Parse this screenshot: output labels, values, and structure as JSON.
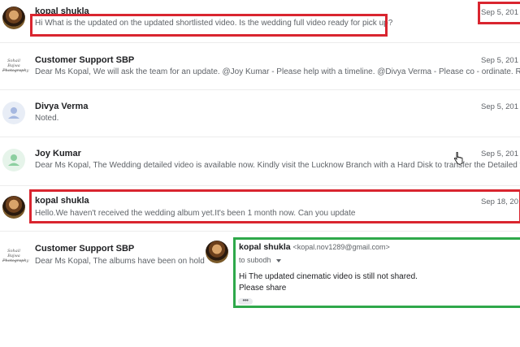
{
  "messages": [
    {
      "sender": "kopal shukla",
      "snippet": "Hi What is the updated on the updated shortlisted video. Is the wedding full video ready for pick up?",
      "date": "Sep 5, 201"
    },
    {
      "sender": "Customer Support SBP",
      "snippet": "Dear Ms Kopal, We will ask the team for an update. @Joy Kumar - Please help with a timeline. @Divya Verma - Please co - ordinate. Rega",
      "date": "Sep 5, 201"
    },
    {
      "sender": "Divya Verma",
      "snippet": "Noted.",
      "date": "Sep 5, 201"
    },
    {
      "sender": "Joy Kumar",
      "snippet": "Dear Ms Kopal, The Wedding detailed video is available now. Kindly visit the Lucknow Branch with a Hard Disk to transfer the Detailed vide",
      "date": "Sep 5, 201"
    },
    {
      "sender": "kopal shukla",
      "snippet": "Hello.We haven't received the wedding album yet.It's been 1 month now. Can you update",
      "date": "Sep 18, 20"
    },
    {
      "sender": "Customer Support SBP",
      "snippet": "Dear Ms Kopal, The albums have been on hold",
      "date": ""
    }
  ],
  "logo_text": "Sohail Bajwa Photography",
  "expanded": {
    "sender": "kopal shukla",
    "email": "<kopal.nov1289@gmail.com>",
    "to": "to subodh",
    "body_line1": "Hi The updated cinematic video is still not shared.",
    "body_line2": "Please share",
    "ellipsis": "•••"
  },
  "colors": {
    "highlight_red": "#d9252f",
    "highlight_green": "#2ea84a"
  }
}
